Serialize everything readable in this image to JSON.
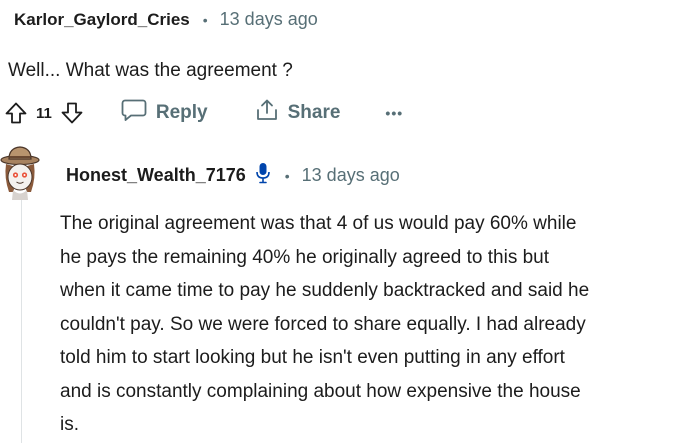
{
  "parent_comment": {
    "username": "Karlor_Gaylord_Cries",
    "separator": "•",
    "timestamp": "13 days ago",
    "body": "Well... What was the agreement ?",
    "vote_count": "11",
    "reply_label": "Reply",
    "share_label": "Share",
    "more_label": "•••"
  },
  "reply_comment": {
    "username": "Honest_Wealth_7176",
    "separator": "•",
    "timestamp": "13 days ago",
    "body_lines": [
      "The original agreement was that 4 of us would pay 60% while",
      "he pays the remaining 40% he originally agreed to this but",
      "when it came time to pay he suddenly backtracked and said he",
      "couldn't pay. So we were forced to share equally. I had already",
      "told him to start looking but he isn't even putting in any effort",
      "and is constantly complaining about how expensive the house",
      "is."
    ]
  },
  "colors": {
    "text_primary": "#1c1c1c",
    "text_secondary": "#576f76",
    "thread_line": "#dfe3e5",
    "mic_icon": "#0045ac"
  },
  "icons": [
    "upvote-icon",
    "downvote-icon",
    "comment-icon",
    "share-icon",
    "more-icon",
    "avatar",
    "microphone-icon"
  ]
}
